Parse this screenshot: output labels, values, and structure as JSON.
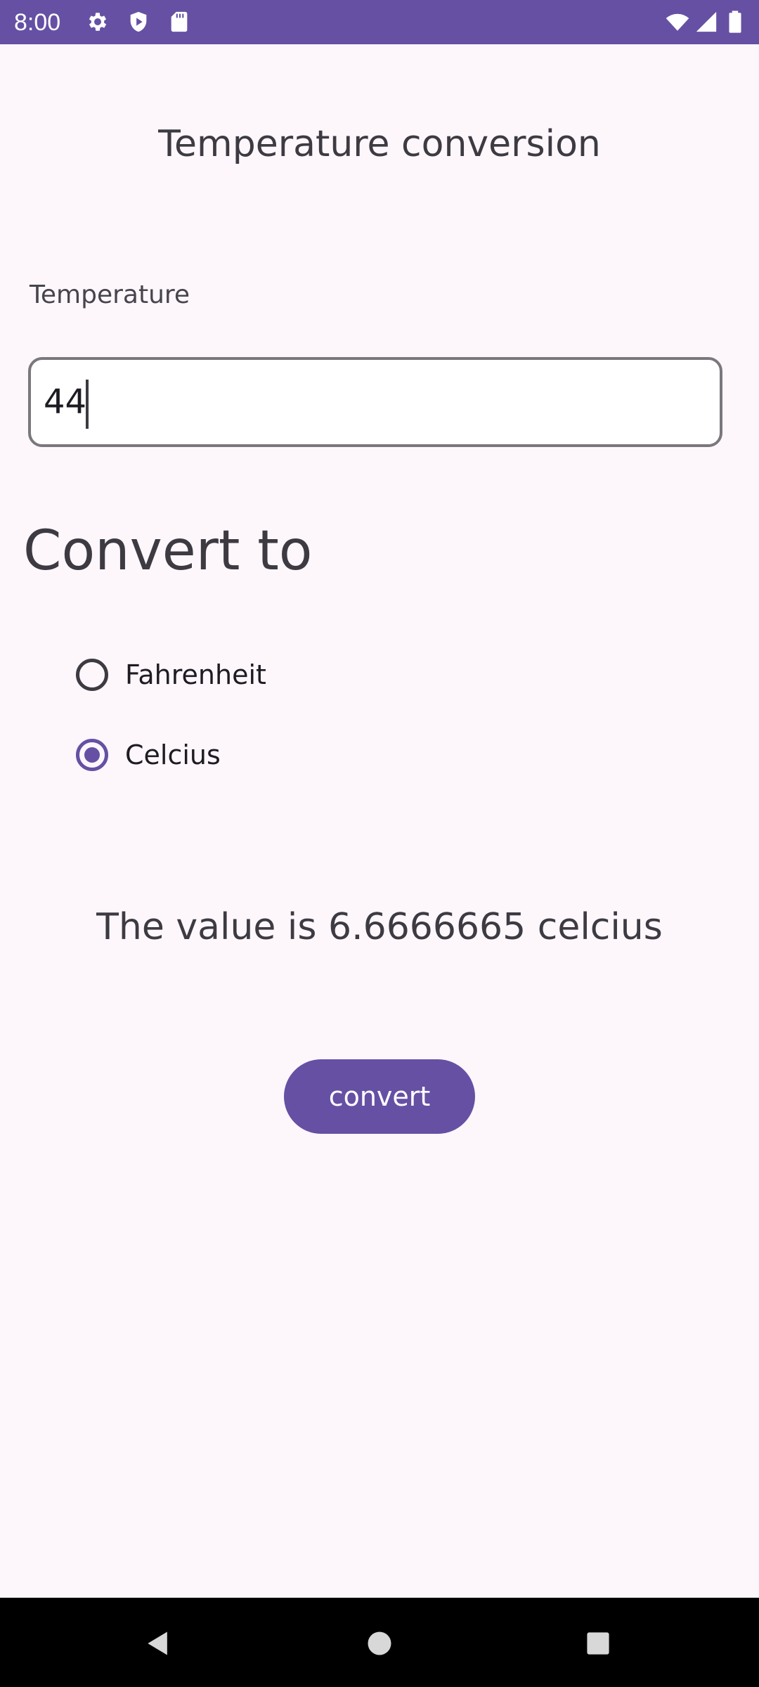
{
  "status_bar": {
    "time": "8:00",
    "left_icons": [
      "settings-icon",
      "shield-play-icon",
      "sd-card-icon"
    ],
    "right_icons": [
      "wifi-icon",
      "signal-icon",
      "battery-icon"
    ],
    "background_color": "#6650a4"
  },
  "app": {
    "title": "Temperature conversion"
  },
  "form": {
    "temperature_label": "Temperature",
    "temperature_value": "44",
    "convert_heading": "Convert to",
    "options": [
      {
        "label": "Fahrenheit",
        "selected": false
      },
      {
        "label": "Celcius",
        "selected": true
      }
    ],
    "result_text": "The value is 6.6666665 celcius",
    "convert_button_label": "convert"
  },
  "nav_bar": {
    "buttons": [
      "back-icon",
      "home-icon",
      "recents-icon"
    ]
  },
  "colors": {
    "accent": "#6650a4",
    "background": "#fdf7fc",
    "text": "#3d3a42"
  }
}
